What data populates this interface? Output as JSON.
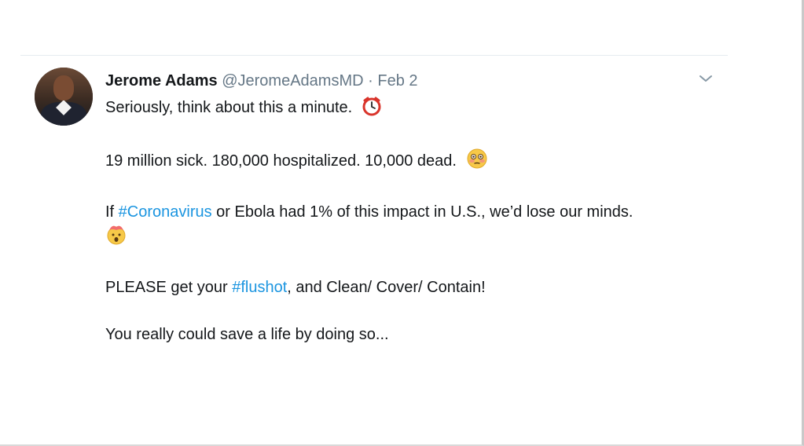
{
  "tweet": {
    "author_name": "Jerome Adams",
    "handle": "@JeromeAdamsMD",
    "separator": "·",
    "date": "Feb 2",
    "lines": {
      "l1": "Seriously, think about this a minute.",
      "l2": "19 million sick. 180,000 hospitalized. 10,000 dead.",
      "l3_prefix": "If ",
      "l3_hashtag": "#Coronavirus",
      "l3_rest": " or Ebola had 1% of this impact in U.S., we’d lose our minds.",
      "l4_prefix": "PLEASE get your ",
      "l4_hashtag": "#flushot",
      "l4_rest": ", and Clean/ Cover/ Contain!",
      "l5": "You really could save a life by doing so..."
    },
    "icons": {
      "l1_emoji": "alarm-clock",
      "l2_emoji": "flushed-face",
      "l3_emoji": "exploding-head",
      "menu": "chevron-down"
    },
    "colors": {
      "hashtag": "#1b95e0",
      "secondary_text": "#657786",
      "primary_text": "#14171a"
    }
  }
}
